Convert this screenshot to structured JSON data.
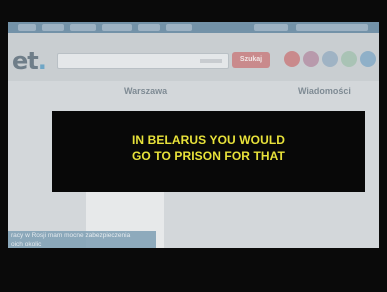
{
  "video": {
    "subtitle_line1": "IN BELARUS YOU WOULD",
    "subtitle_line2": "GO TO PRISON FOR THAT"
  },
  "website": {
    "logo": "et",
    "logo_dot": ".",
    "search_button": "Szukaj",
    "section_title_1": "Warszawa",
    "section_title_2": "Wiadomości",
    "news_caption_line1": "racy w Rosji mam mocne zabezpieczenia",
    "news_caption_line2": "oich okolic"
  },
  "colors": {
    "subtitle_text": "#e8e23a",
    "overlay_bg": "#080808",
    "circle_1": "#c98a8c",
    "circle_2": "#b89aac",
    "circle_3": "#9fb3c4",
    "circle_4": "#a9c3b5",
    "circle_5": "#8fb0c8"
  }
}
